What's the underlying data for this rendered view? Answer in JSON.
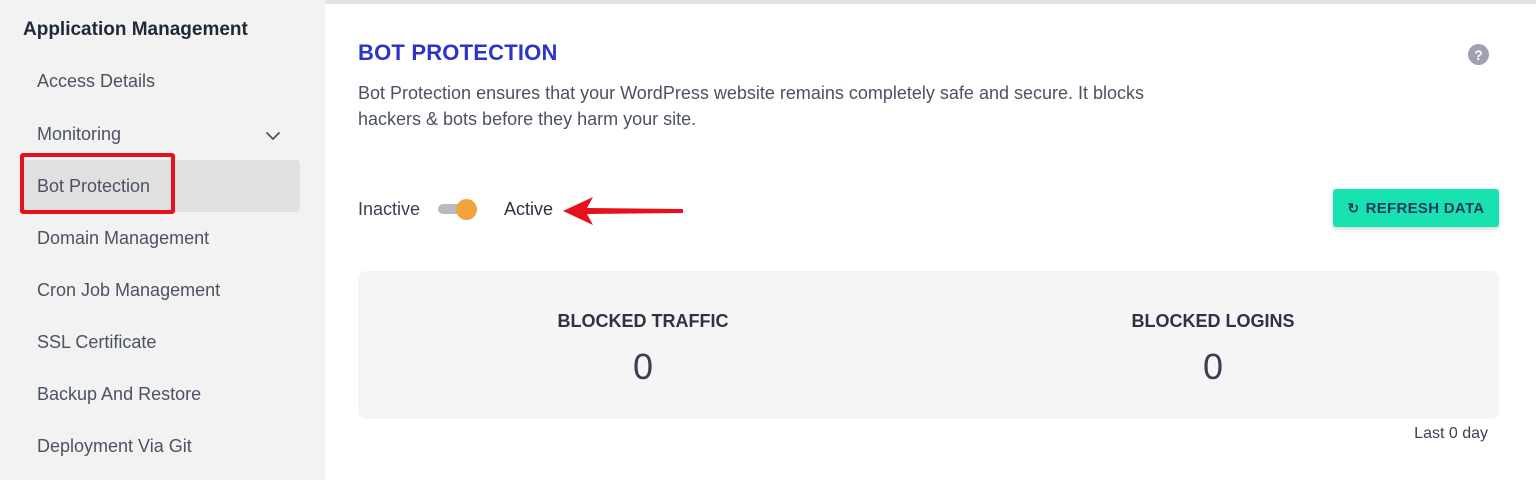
{
  "sidebar": {
    "title": "Application Management",
    "items": [
      {
        "label": "Access Details"
      },
      {
        "label": "Monitoring"
      },
      {
        "label": "Bot Protection"
      },
      {
        "label": "Domain Management"
      },
      {
        "label": "Cron Job Management"
      },
      {
        "label": "SSL Certificate"
      },
      {
        "label": "Backup And Restore"
      },
      {
        "label": "Deployment Via Git"
      }
    ],
    "active_item": "Bot Protection"
  },
  "panel": {
    "title": "BOT PROTECTION",
    "help_icon": "?",
    "description": "Bot Protection ensures that your WordPress website remains completely safe and secure. It blocks hackers & bots before they harm your site.",
    "toggle": {
      "off_label": "Inactive",
      "on_label": "Active",
      "state": "on"
    },
    "refresh_button": {
      "icon": "↻",
      "label": "REFRESH DATA"
    },
    "stats": [
      {
        "label": "BLOCKED TRAFFIC",
        "value": "0"
      },
      {
        "label": "BLOCKED LOGINS",
        "value": "0"
      }
    ],
    "period": "Last 0 day"
  },
  "colors": {
    "title": "#2b36c7",
    "toggle_knob": "#f3a33b",
    "refresh_button": "#17e2b0",
    "annotation_red": "#e8101a"
  },
  "icons": [
    "chevron-down-icon",
    "help-icon",
    "refresh-icon",
    "annotation-arrow-icon"
  ]
}
